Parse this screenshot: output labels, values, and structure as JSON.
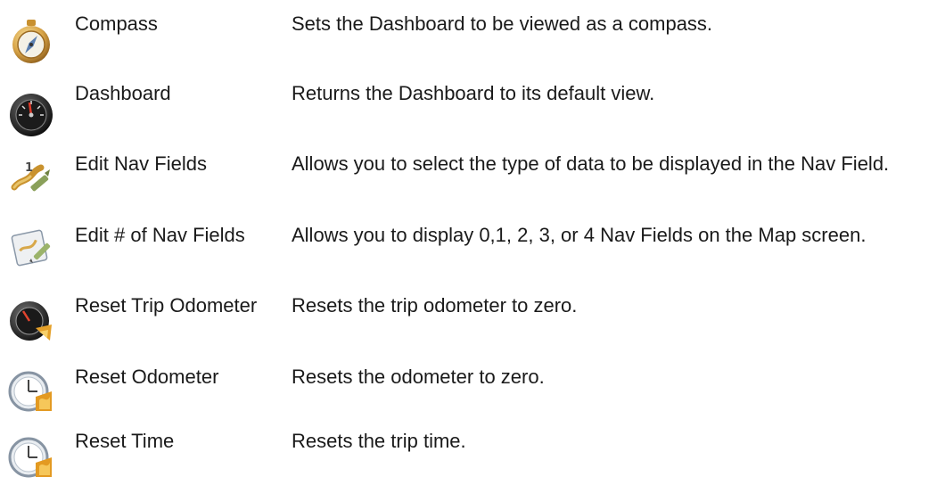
{
  "rows": [
    {
      "name": "Compass",
      "description": "Sets the Dashboard to be viewed as a compass.",
      "icon": "compass-icon"
    },
    {
      "name": "Dashboard",
      "description": "Returns the Dashboard to its default view.",
      "icon": "dashboard-gauge-icon"
    },
    {
      "name": "Edit Nav Fields",
      "description": "Allows you to select the type of data to be displayed in the Nav Field.",
      "icon": "edit-nav-fields-icon"
    },
    {
      "name": "Edit # of Nav Fields",
      "description": "Allows you to display 0,1, 2, 3, or 4 Nav Fields on the Map screen.",
      "icon": "edit-number-of-nav-fields-icon"
    },
    {
      "name": "Reset Trip Odometer",
      "description": "Resets the trip odometer to zero.",
      "icon": "reset-trip-odometer-icon"
    },
    {
      "name": "Reset Odometer",
      "description": "Resets the odometer to zero.",
      "icon": "reset-odometer-icon"
    },
    {
      "name": "Reset Time",
      "description": "Resets the trip time.",
      "icon": "reset-time-icon"
    }
  ]
}
